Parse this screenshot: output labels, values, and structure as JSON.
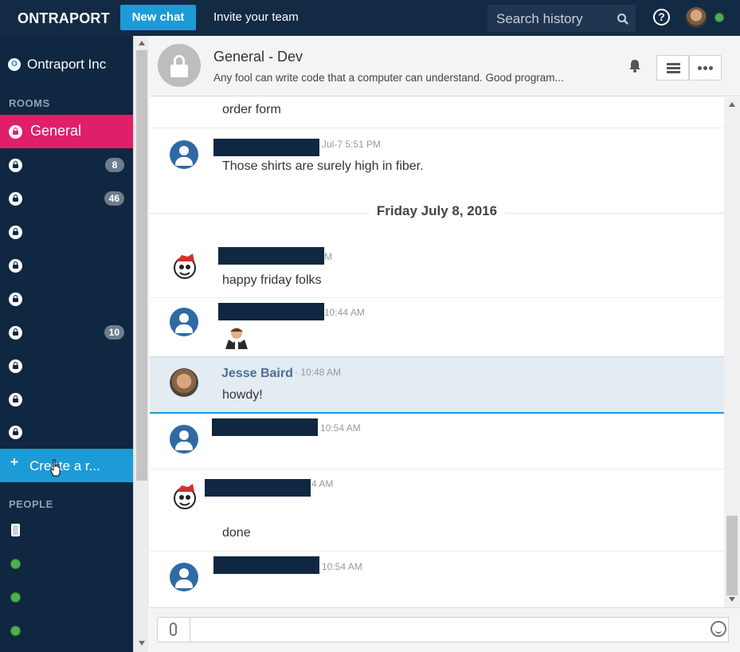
{
  "topbar": {
    "logo": "ONTRAPORT",
    "new_chat": "New chat",
    "invite": "Invite your team",
    "search_placeholder": "Search history"
  },
  "sidebar": {
    "org_name": "Ontraport Inc",
    "rooms_label": "ROOMS",
    "rooms": [
      {
        "label": "General",
        "active": true,
        "badge": ""
      },
      {
        "label": "",
        "badge": "8"
      },
      {
        "label": "",
        "badge": "46"
      },
      {
        "label": "",
        "badge": ""
      },
      {
        "label": "",
        "badge": ""
      },
      {
        "label": "",
        "badge": ""
      },
      {
        "label": "",
        "badge": "10"
      },
      {
        "label": "",
        "badge": ""
      },
      {
        "label": "",
        "badge": ""
      },
      {
        "label": "",
        "badge": ""
      }
    ],
    "create_room": "Create a r...",
    "people_label": "PEOPLE"
  },
  "room": {
    "title": "General - Dev",
    "topic": "Any fool can write code that a computer can understand. Good program..."
  },
  "messages": {
    "m0_text": "order form",
    "m1_time": "Jul-7 5:51 PM",
    "m1_text": "Those shirts are surely high in fiber.",
    "date_divider": "Friday July 8, 2016",
    "m2_time": "M",
    "m2_text": "happy friday folks",
    "m3_time": "10:44 AM",
    "m4_name": "Jesse Baird",
    "m4_time": "· 10:48 AM",
    "m4_text": "howdy!",
    "m5_time": "10:54 AM",
    "m6_time": "4 AM",
    "m6_text": "done",
    "m7_time": "10:54 AM"
  },
  "colors": {
    "topbar": "#132a45",
    "sidebar": "#0f2740",
    "accent_blue": "#1d9bd6",
    "active_room": "#e01f69",
    "online": "#4caf50"
  }
}
